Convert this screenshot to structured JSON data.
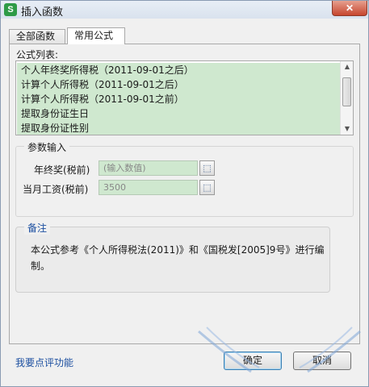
{
  "window": {
    "title": "插入函数",
    "app_icon": "S",
    "close_label": "✕"
  },
  "tabs": [
    {
      "label": "全部函数",
      "selected": false
    },
    {
      "label": "常用公式",
      "selected": true
    }
  ],
  "formula_list": {
    "label": "公式列表:",
    "items": [
      "个人年终奖所得税（2011-09-01之后）",
      "计算个人所得税（2011-09-01之后）",
      "计算个人所得税（2011-09-01之前）",
      "提取身份证生日",
      "提取身份证性别"
    ]
  },
  "params": {
    "title": "参数输入",
    "fields": [
      {
        "label": "年终奖(税前)",
        "value": "",
        "placeholder": "(输入数值)"
      },
      {
        "label": "当月工资(税前)",
        "value": "3500",
        "placeholder": ""
      }
    ]
  },
  "note": {
    "title": "备注",
    "text": "本公式参考《个人所得税法(2011)》和《国税发[2005]9号》进行编制。"
  },
  "footer": {
    "feedback_link": "我要点评功能",
    "ok_label": "确定",
    "cancel_label": "取消"
  },
  "colors": {
    "list_highlight": "#cfe8cf",
    "link": "#1c4fa0",
    "title_close": "#c7462e"
  }
}
